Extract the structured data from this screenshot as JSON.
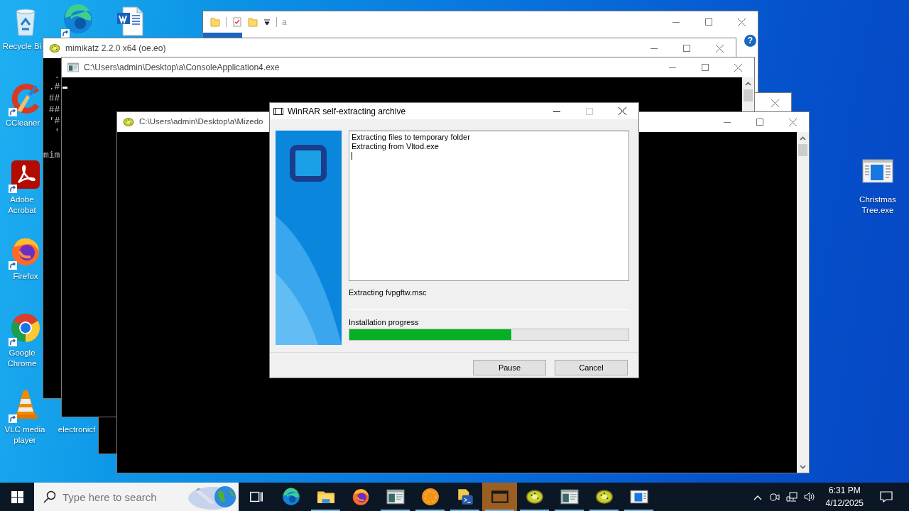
{
  "desktop": {
    "icons": [
      {
        "kind": "recycle-bin",
        "label": "Recycle Bi",
        "shortcut": false
      },
      {
        "kind": "edge",
        "shortcut": true
      },
      {
        "kind": "word",
        "shortcut": false
      },
      {
        "kind": "ccleaner",
        "label": "CCleaner",
        "shortcut": true
      },
      {
        "kind": "acrobat",
        "label": "Adobe Acrobat",
        "shortcut": true
      },
      {
        "kind": "firefox",
        "label": "Firefox",
        "shortcut": true
      },
      {
        "kind": "chrome",
        "label": "Google Chrome",
        "shortcut": true
      },
      {
        "kind": "vlc",
        "label": "VLC media player",
        "shortcut": true
      },
      {
        "label": "electronicf",
        "shortcut": false
      },
      {
        "kind": "exe",
        "label": "Christmas Tree.exe",
        "shortcut": false
      }
    ]
  },
  "windows": [
    {
      "kind": "explorer",
      "title": "a",
      "quick_access": [
        {
          "kind": "folder"
        },
        {
          "kind": "properties"
        },
        {
          "kind": "folder"
        },
        {
          "kind": "customize"
        }
      ],
      "help": "?",
      "controls": [
        {
          "kind": "minimize",
          "disabled": false
        },
        {
          "kind": "maximize",
          "disabled": false
        },
        {
          "kind": "close",
          "disabled": false
        }
      ]
    },
    {
      "kind": "kiwi",
      "title": "mimikatz 2.2.0 x64 (oe.eo)",
      "banner_lines": [
        "  .",
        " .#",
        " ##",
        " ##",
        " '#",
        "  '"
      ],
      "prompt": "mim",
      "controls": [
        {
          "kind": "minimize",
          "disabled": false
        },
        {
          "kind": "maximize",
          "disabled": false
        },
        {
          "kind": "close",
          "disabled": false
        }
      ]
    },
    {
      "kind": "console",
      "controls": [
        {
          "kind": "close",
          "disabled": false
        }
      ]
    },
    {
      "kind": "console",
      "title": "C:\\Users\\admin\\Desktop\\a\\ConsoleApplication4.exe",
      "cursor": true,
      "scrollbar": true,
      "controls": [
        {
          "kind": "minimize",
          "disabled": false
        },
        {
          "kind": "maximize",
          "disabled": false
        },
        {
          "kind": "close",
          "disabled": false
        }
      ]
    },
    {
      "kind": "kiwi",
      "title": "C:\\Users\\admin\\Desktop\\a\\Mizedo",
      "scrollbar": true,
      "controls": [
        {
          "kind": "minimize",
          "disabled": false
        },
        {
          "kind": "maximize",
          "disabled": false
        },
        {
          "kind": "close",
          "disabled": false
        }
      ]
    }
  ],
  "dialog": {
    "title": "WinRAR self-extracting archive",
    "controls": [
      {
        "kind": "minimize",
        "disabled": false
      },
      {
        "kind": "maximize",
        "disabled": true
      },
      {
        "kind": "close",
        "disabled": false
      }
    ],
    "log": [
      "Extracting files to temporary folder",
      "Extracting from Vltod.exe"
    ],
    "status": "Extracting fvpgftw.msc",
    "progress_label": "Installation progress",
    "progress": {
      "level": 0.58
    },
    "buttons": [
      "Pause",
      "Cancel"
    ]
  },
  "taskbar": {
    "search": {
      "placeholder": "Type here to search"
    },
    "items": [
      {
        "kind": "task-view",
        "running": false,
        "selected": false
      },
      {
        "kind": "edge",
        "running": false,
        "selected": false
      },
      {
        "kind": "folder",
        "running": true,
        "selected": false
      },
      {
        "kind": "firefox",
        "running": false,
        "selected": false
      },
      {
        "kind": "terminal",
        "running": true,
        "selected": false
      },
      {
        "kind": "orange",
        "running": true,
        "selected": false
      },
      {
        "kind": "script",
        "running": true,
        "selected": false
      },
      {
        "kind": "frame",
        "running": true,
        "selected": true
      },
      {
        "kind": "kiwi",
        "running": true,
        "selected": false
      },
      {
        "kind": "terminal",
        "running": true,
        "selected": false
      },
      {
        "kind": "kiwi",
        "running": true,
        "selected": false
      },
      {
        "kind": "blue-app",
        "running": true,
        "selected": false
      }
    ],
    "tray": [
      {
        "kind": "chevron"
      },
      {
        "kind": "camera"
      },
      {
        "kind": "network"
      },
      {
        "kind": "volume"
      }
    ],
    "clock": {
      "time": "6:31 PM",
      "date": "4/12/2025"
    }
  }
}
